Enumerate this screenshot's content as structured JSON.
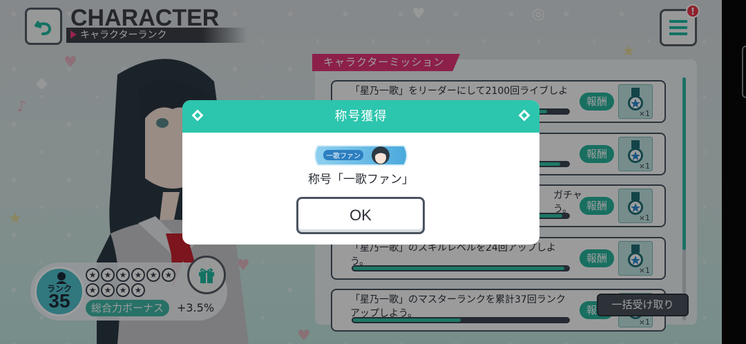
{
  "header": {
    "title": "CHARACTER",
    "subtitle": "キャラクターランク",
    "back_icon": "back-arrow-icon",
    "menu_icon": "hamburger-menu-icon",
    "menu_badge": "!"
  },
  "rank": {
    "label": "ランク",
    "value": "35",
    "stars_total": 10,
    "bonus_label": "総合力ボーナス",
    "bonus_value": "+3.5%",
    "gift_icon": "gift-icon"
  },
  "missions": {
    "tab_label": "キャラクターミッション",
    "items": [
      {
        "text": "「星乃一歌」をリーダーにして2100回ライブしよう",
        "reward_label": "報酬",
        "reward_count": "×1",
        "progress": 0.9
      },
      {
        "text": "",
        "reward_label": "報酬",
        "reward_count": "×1",
        "progress": 0.96
      },
      {
        "text": "ガチャ\nう。",
        "reward_label": "報酬",
        "reward_count": "×1",
        "progress": 0.97
      },
      {
        "text": "「星乃一歌」のスキルレベルを24回アップしよう。",
        "reward_label": "報酬",
        "reward_count": "×1",
        "progress": 0.98
      },
      {
        "text": "「星乃一歌」のマスターランクを累計37回ランクアップしよう。",
        "reward_label": "報酬",
        "reward_count": "×1",
        "progress": 0.5
      }
    ],
    "bulk_button": "一括受け取り"
  },
  "modal": {
    "title": "称号獲得",
    "badge_text": "一歌ファン",
    "message": "称号「一歌ファン」",
    "ok_label": "OK"
  },
  "colors": {
    "accent_teal": "#2cc5ad",
    "accent_pink": "#e3357a",
    "dark": "#3c3f47"
  }
}
